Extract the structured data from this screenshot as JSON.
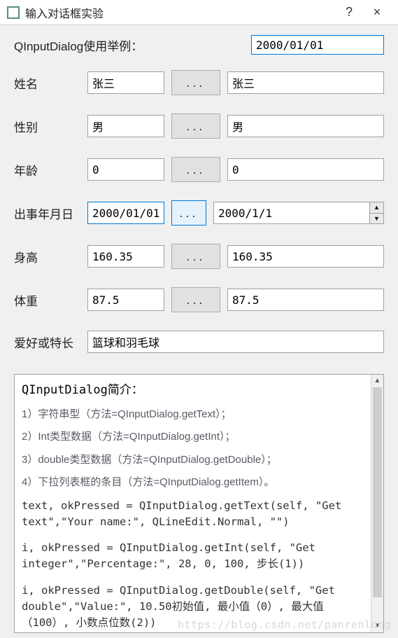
{
  "window": {
    "title": "输入对话框实验",
    "help": "?",
    "close": "×"
  },
  "header": {
    "label": "QInputDialog使用举例：",
    "value": "2000/01/01"
  },
  "rows": {
    "name": {
      "label": "姓名",
      "leftValue": "张三",
      "btn": "...",
      "rightValue": "张三"
    },
    "gender": {
      "label": "性别",
      "leftValue": "男",
      "btn": "...",
      "rightValue": "男"
    },
    "age": {
      "label": "年龄",
      "leftValue": "0",
      "btn": "...",
      "rightValue": "0"
    },
    "date": {
      "label": "出事年月日",
      "leftValue": "2000/01/01",
      "btn": "...",
      "rightValue": "2000/1/1"
    },
    "height": {
      "label": "身高",
      "leftValue": "160.35",
      "btn": "...",
      "rightValue": "160.35"
    },
    "weight": {
      "label": "体重",
      "leftValue": "87.5",
      "btn": "...",
      "rightValue": "87.5"
    }
  },
  "hobby": {
    "label": "爱好或特长",
    "value": "篮球和羽毛球"
  },
  "info": {
    "heading": "QInputDialog简介：",
    "item1": "1）字符串型（方法=QInputDialog.getText）；",
    "item2": "2）Int类型数据（方法=QInputDialog.getInt）；",
    "item3": "3）double类型数据（方法=QInputDialog.getDouble）；",
    "item4": "4）下拉列表框的条目（方法=QInputDialog.getItem）。",
    "code1": "text, okPressed = QInputDialog.getText(self, \"Get text\",\"Your name:\", QLineEdit.Normal, \"\")",
    "code2": "i, okPressed = QInputDialog.getInt(self, \"Get integer\",\"Percentage:\", 28, 0, 100, 步长(1))",
    "code3": "i, okPressed = QInputDialog.getDouble(self, \"Get double\",\"Value:\", 10.50初始值, 最小值（0）, 最大值（100）, 小数点位数(2))"
  },
  "watermark": "https://blog.csdn.net/panrenlong"
}
